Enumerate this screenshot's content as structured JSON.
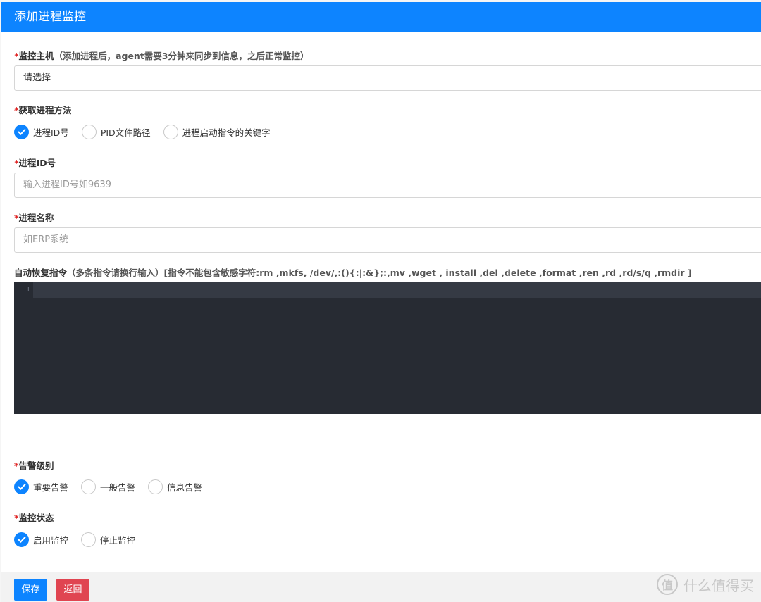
{
  "header": {
    "title": "添加进程监控"
  },
  "host": {
    "label": "监控主机",
    "hint": "（添加进程后，agent需要3分钟来同步到信息，之后正常监控）",
    "selected": "请选择"
  },
  "method": {
    "label": "获取进程方法",
    "options": [
      {
        "label": "进程ID号",
        "checked": true
      },
      {
        "label": "PID文件路径",
        "checked": false
      },
      {
        "label": "进程启动指令的关键字",
        "checked": false
      }
    ]
  },
  "pid": {
    "label": "进程ID号",
    "placeholder": "输入进程ID号如9639"
  },
  "name": {
    "label": "进程名称",
    "placeholder": "如ERP系统"
  },
  "recovery": {
    "label": "自动恢复指令",
    "hint": "（多条指令请换行输入）[指令不能包含敏感字符:rm ,mkfs, /dev/,:(){:|:&};:,mv ,wget , install ,del ,delete ,format ,ren ,rd ,rd/s/q ,rmdir ]",
    "line_number": "1"
  },
  "level": {
    "label": "告警级别",
    "options": [
      {
        "label": "重要告警",
        "checked": true
      },
      {
        "label": "一般告警",
        "checked": false
      },
      {
        "label": "信息告警",
        "checked": false
      }
    ]
  },
  "status": {
    "label": "监控状态",
    "options": [
      {
        "label": "启用监控",
        "checked": true
      },
      {
        "label": "停止监控",
        "checked": false
      }
    ]
  },
  "buttons": {
    "save": "保存",
    "back": "返回"
  },
  "required_mark": "*",
  "watermark": {
    "icon_text": "值",
    "text": "什么值得买"
  },
  "colors": {
    "primary": "#0d84ff",
    "danger": "#e04551",
    "editor_bg": "#272b33"
  }
}
